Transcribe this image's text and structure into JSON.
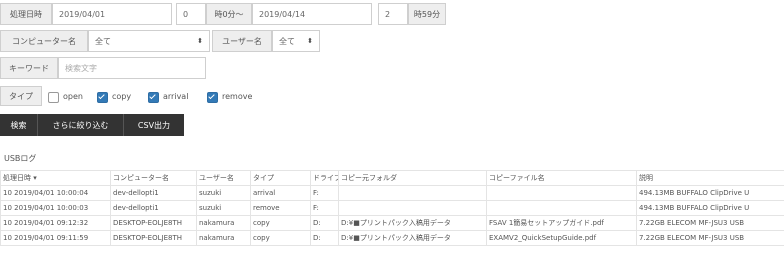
{
  "search": {
    "date_label": "処理日時",
    "start_date": "2019/04/01",
    "start_hour": "0",
    "start_hour_suffix": "時0分～",
    "end_date": "2019/04/14",
    "end_hour": "2",
    "end_hour_suffix": "時59分",
    "computer_label": "コンピューター名",
    "computer_value": "全て",
    "user_label": "ユーザー名",
    "user_value": "全て",
    "keyword_label": "キーワード",
    "keyword_placeholder": "検索文字",
    "type_label": "タイプ",
    "types": [
      {
        "label": "open",
        "checked": false
      },
      {
        "label": "copy",
        "checked": true
      },
      {
        "label": "arrival",
        "checked": true
      },
      {
        "label": "remove",
        "checked": true
      }
    ],
    "buttons": {
      "search": "検索",
      "refine": "さらに絞り込む",
      "csv": "CSV出力"
    }
  },
  "log": {
    "title": "USBログ",
    "columns": [
      "処理日時 ▾",
      "コンピューター名",
      "ユーザー名",
      "タイプ",
      "ドライブ",
      "コピー元フォルダ",
      "コピーファイル名",
      "説明"
    ],
    "rows": [
      [
        "10 2019/04/01 10:00:04",
        "dev-dellopti1",
        "suzuki",
        "arrival",
        "F:",
        "",
        "",
        "494.13MB BUFFALO ClipDrive U"
      ],
      [
        "10 2019/04/01 10:00:03",
        "dev-dellopti1",
        "suzuki",
        "remove",
        "F:",
        "",
        "",
        "494.13MB BUFFALO ClipDrive U"
      ],
      [
        "10 2019/04/01 09:12:32",
        "DESKTOP-EOLJE8TH",
        "nakamura",
        "copy",
        "D:",
        "D:¥■プリントパック入稿用データ",
        "FSAV 1簡易セットアップガイド.pdf",
        "7.22GB ELECOM MF-JSU3 USB"
      ],
      [
        "10 2019/04/01 09:11:59",
        "DESKTOP-EOLJE8TH",
        "nakamura",
        "copy",
        "D:",
        "D:¥■プリントパック入稿用データ",
        "EXAMV2_QuickSetupGuide.pdf",
        "7.22GB ELECOM MF-JSU3 USB"
      ]
    ]
  }
}
